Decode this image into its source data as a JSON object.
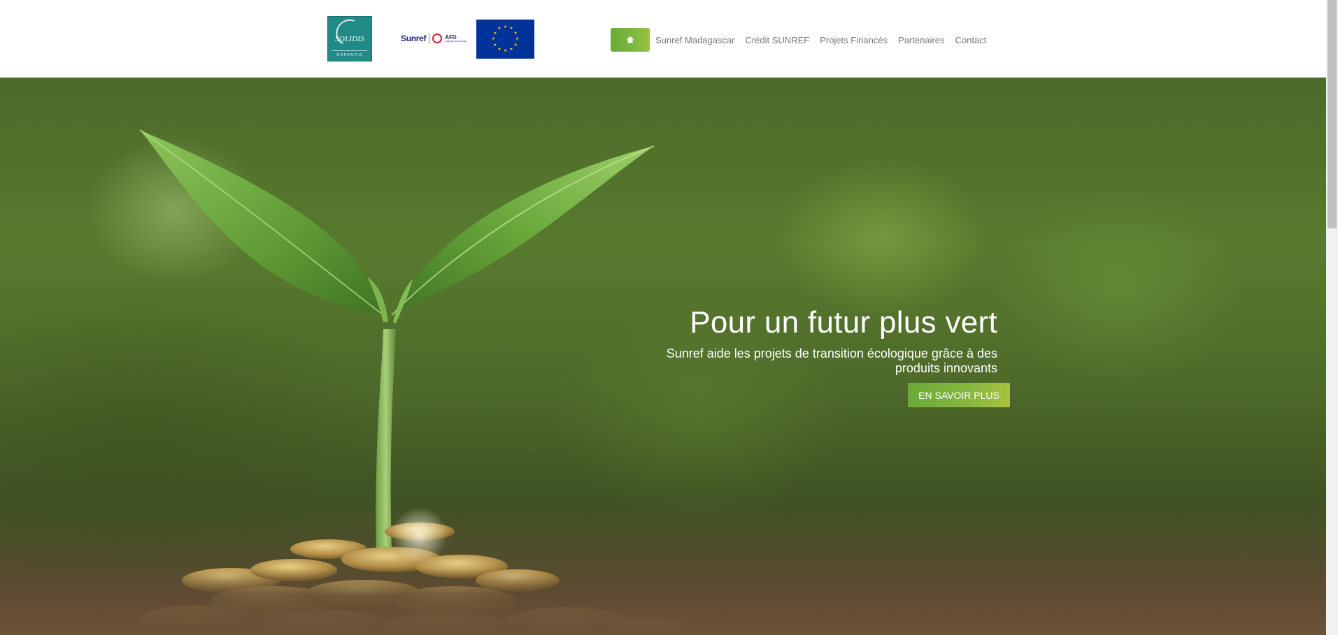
{
  "header": {
    "logos": {
      "solidis": {
        "name": "SOLIDIS",
        "sub": "GARANTIE"
      },
      "sunref": {
        "name": "Sunref",
        "partner": "AFD",
        "partner_sub": "AGENCE FRANÇAISE"
      },
      "eu": {
        "icon": "eu-flag-icon"
      }
    },
    "nav": {
      "home_icon": "home-icon",
      "items": [
        {
          "label": "Sunref Madagascar"
        },
        {
          "label": "Crédit SUNREF"
        },
        {
          "label": "Projets Financés"
        },
        {
          "label": "Partenaires"
        },
        {
          "label": "Contact"
        }
      ]
    }
  },
  "hero": {
    "title": "Pour un futur plus vert",
    "subtitle": "Sunref aide les projets de transition écologique grâce à des produits innovants",
    "cta_label": "EN SAVOIR PLUS"
  },
  "colors": {
    "accent_start": "#6aaa3a",
    "accent_end": "#a8c23e",
    "nav_text": "#777777",
    "solidis_teal": "#1f8a86",
    "eu_blue": "#003399",
    "eu_star": "#ffcc00"
  }
}
